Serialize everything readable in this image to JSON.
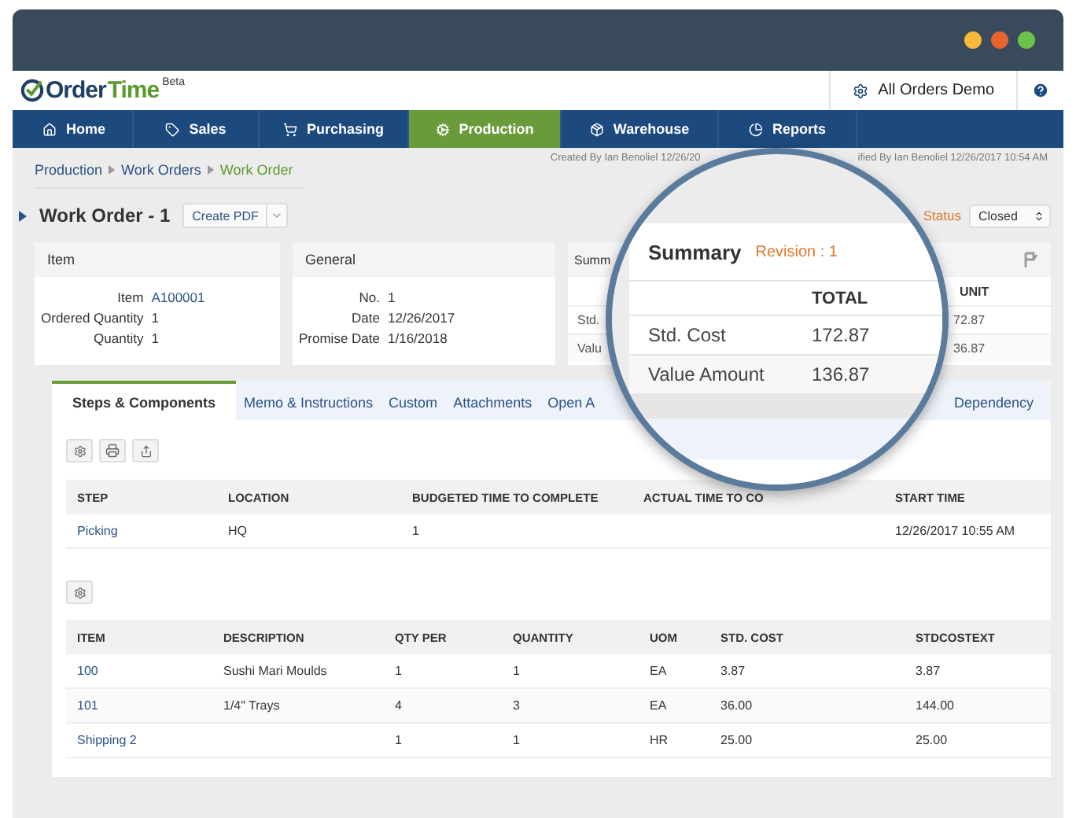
{
  "logo": {
    "part_1": "Order",
    "part_2": "Time",
    "badge": "Beta"
  },
  "account": {
    "label": "All Orders Demo"
  },
  "nav": [
    {
      "label": "Home",
      "selected": false
    },
    {
      "label": "Sales",
      "selected": false
    },
    {
      "label": "Purchasing",
      "selected": false
    },
    {
      "label": "Production",
      "selected": true
    },
    {
      "label": "Warehouse",
      "selected": false
    },
    {
      "label": "Reports",
      "selected": false
    }
  ],
  "breadcrumbs": [
    {
      "label": "Production",
      "current": false
    },
    {
      "label": "Work Orders",
      "current": false
    },
    {
      "label": "Work Order",
      "current": true
    }
  ],
  "audit": [
    "Created By Ian Benoliel 12/26/20",
    "ified By Ian Benoliel 12/26/2017 10:54 AM"
  ],
  "title": "Work Order - 1",
  "create_button": "Create PDF",
  "status": {
    "label": "Status",
    "value": "Closed"
  },
  "panels": [
    {
      "title": "Item",
      "rows": [
        {
          "label": "Item",
          "value": "A100001",
          "link": true
        },
        {
          "label": "Ordered Quantity",
          "value": "1",
          "link": false
        },
        {
          "label": "Quantity",
          "value": "1",
          "link": false
        }
      ]
    },
    {
      "title": "General",
      "rows": [
        {
          "label": "No.",
          "value": "1",
          "link": false
        },
        {
          "label": "Date",
          "value": "12/26/2017",
          "link": false
        },
        {
          "label": "Promise Date",
          "value": "1/16/2018",
          "link": false
        }
      ]
    }
  ],
  "summary_panel": {
    "title": "Summ",
    "column": "UNIT",
    "rows": [
      {
        "label": "Std.",
        "value": "72.87"
      },
      {
        "label": "Valu",
        "value": "36.87"
      }
    ]
  },
  "tabs": [
    {
      "label": "Steps & Components",
      "selected": true
    },
    {
      "label": "Memo & Instructions",
      "selected": false
    },
    {
      "label": "Custom",
      "selected": false
    },
    {
      "label": "Attachments",
      "selected": false
    },
    {
      "label": "Open A",
      "selected": false
    },
    {
      "label": "Dependency",
      "selected": false
    }
  ],
  "steps_table": {
    "columns": [
      "STEP",
      "LOCATION",
      "BUDGETED TIME TO COMPLETE",
      "ACTUAL TIME TO CO",
      "START TIME"
    ],
    "rows": [
      [
        "Picking",
        "HQ",
        "1",
        "",
        "12/26/2017 10:55 AM"
      ]
    ]
  },
  "components_table": {
    "columns": [
      "ITEM",
      "DESCRIPTION",
      "QTY PER",
      "QUANTITY",
      "UOM",
      "STD. COST",
      "STDCOSTEXT"
    ],
    "rows": [
      [
        "100",
        "Sushi Mari Moulds",
        "1",
        "1",
        "EA",
        "3.87",
        "3.87"
      ],
      [
        "101",
        "1/4\" Trays",
        "4",
        "3",
        "EA",
        "36.00",
        "144.00"
      ],
      [
        "Shipping 2",
        "",
        "1",
        "1",
        "HR",
        "25.00",
        "25.00"
      ]
    ]
  },
  "magnifier": {
    "title": "Summary",
    "revision": "Revision : 1",
    "column": "TOTAL",
    "rows": [
      {
        "label": "Std. Cost",
        "value": "172.87"
      },
      {
        "label": "Value Amount",
        "value": "136.87"
      }
    ]
  }
}
